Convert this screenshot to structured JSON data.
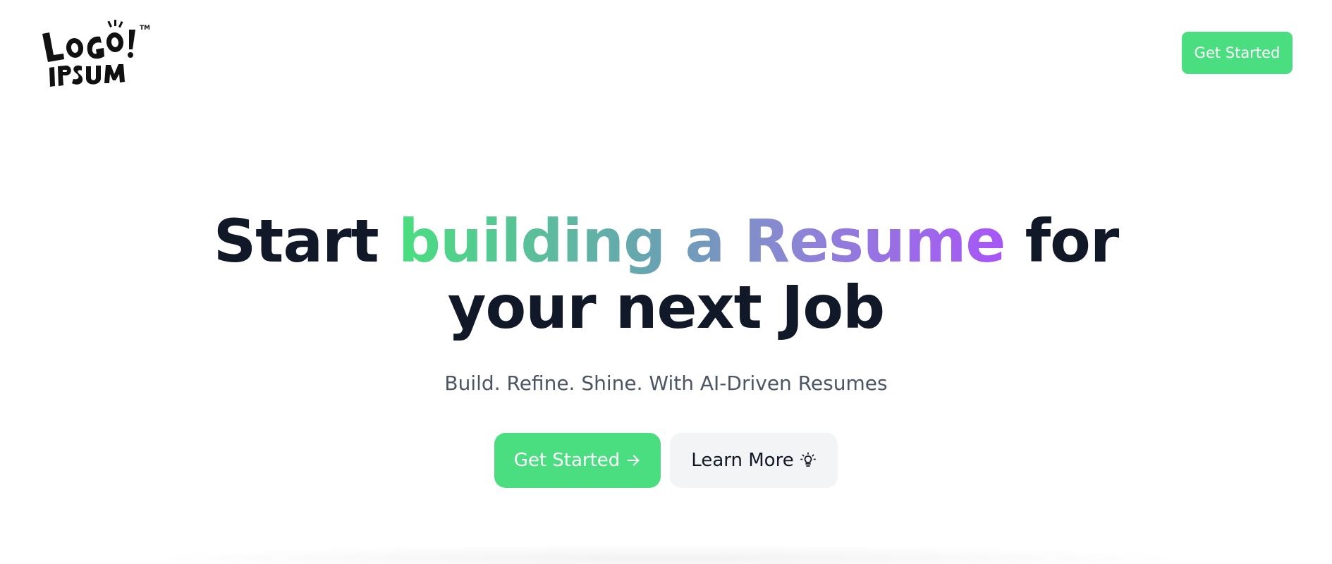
{
  "header": {
    "logo_name": "logo-ipsum",
    "logo_text_top": "LOGO!",
    "logo_text_bottom": "IPSUM",
    "logo_tm": "TM",
    "cta_label": "Get Started"
  },
  "hero": {
    "title_part1": "Start ",
    "title_highlight": "building a Resume",
    "title_part2": " for",
    "title_line2": "your next Job",
    "subtitle": "Build. Refine. Shine. With AI-Driven Resumes",
    "primary_label": "Get Started",
    "primary_icon": "arrow-right-icon",
    "secondary_label": "Learn More",
    "secondary_icon": "lightbulb-icon"
  },
  "colors": {
    "accent_green": "#4ade80",
    "accent_purple": "#a855f7",
    "heading": "#111827",
    "subtext": "#4b5563",
    "secondary_bg": "#f3f4f6"
  }
}
